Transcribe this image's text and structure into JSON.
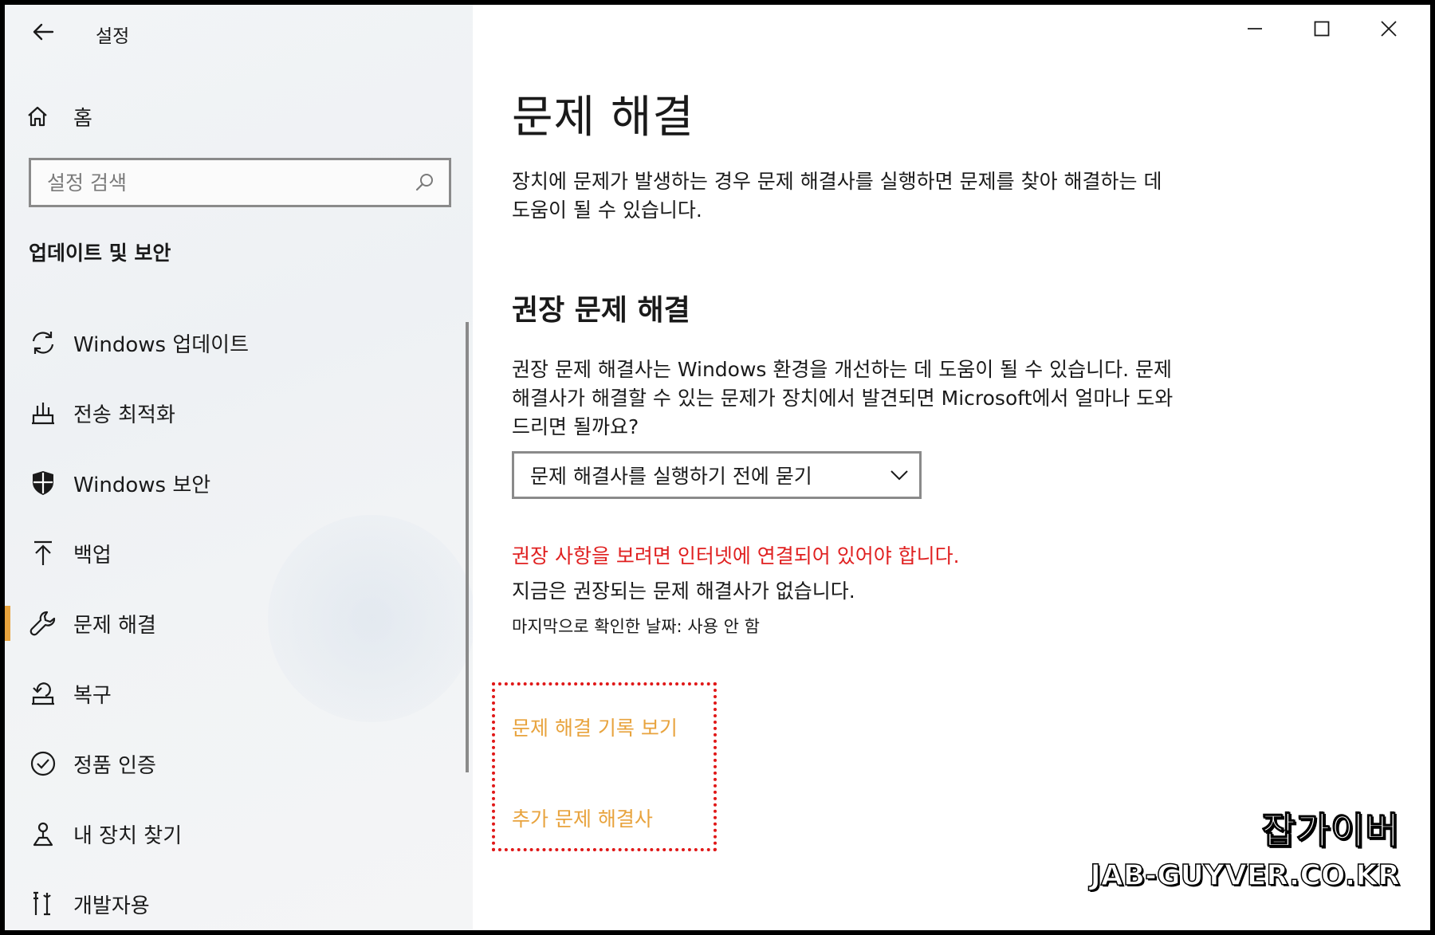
{
  "window": {
    "app_title": "설정",
    "controls": {
      "minimize": "minimize-icon",
      "maximize": "maximize-icon",
      "close": "close-icon"
    }
  },
  "sidebar": {
    "home_label": "홈",
    "search_placeholder": "설정 검색",
    "section_heading": "업데이트 및 보안",
    "items": [
      {
        "label": "Windows 업데이트",
        "icon": "sync-icon"
      },
      {
        "label": "전송 최적화",
        "icon": "delivery-optimization-icon"
      },
      {
        "label": "Windows 보안",
        "icon": "shield-icon"
      },
      {
        "label": "백업",
        "icon": "backup-arrow-icon"
      },
      {
        "label": "문제 해결",
        "icon": "wrench-icon",
        "selected": true
      },
      {
        "label": "복구",
        "icon": "recovery-icon"
      },
      {
        "label": "정품 인증",
        "icon": "check-circle-icon"
      },
      {
        "label": "내 장치 찾기",
        "icon": "find-device-icon"
      },
      {
        "label": "개발자용",
        "icon": "developer-tools-icon"
      }
    ]
  },
  "main": {
    "title": "문제 해결",
    "intro": "장치에 문제가 발생하는 경우 문제 해결사를 실행하면 문제를 찾아 해결하는 데 도움이 될 수 있습니다.",
    "recommended_title": "권장 문제 해결",
    "recommended_desc": "권장 문제 해결사는 Windows 환경을 개선하는 데 도움이 될 수 있습니다. 문제 해결사가 해결할 수 있는 문제가 장치에서 발견되면 Microsoft에서 얼마나 도와드리면 될까요?",
    "dropdown_value": "문제 해결사를 실행하기 전에 묻기",
    "warning": "권장 사항을 보려면 인터넷에 연결되어 있어야 합니다.",
    "status": "지금은 권장되는 문제 해결사가 없습니다.",
    "last_checked": "마지막으로 확인한 날짜: 사용 안 함",
    "link_history": "문제 해결 기록 보기",
    "link_extra": "추가 문제 해결사"
  },
  "watermark": {
    "korean": "잡가이버",
    "domain": "JAB-GUYVER.CO.KR"
  },
  "colors": {
    "accent": "#e8a33d",
    "warning": "#e02020",
    "highlight_border": "#e01818"
  }
}
